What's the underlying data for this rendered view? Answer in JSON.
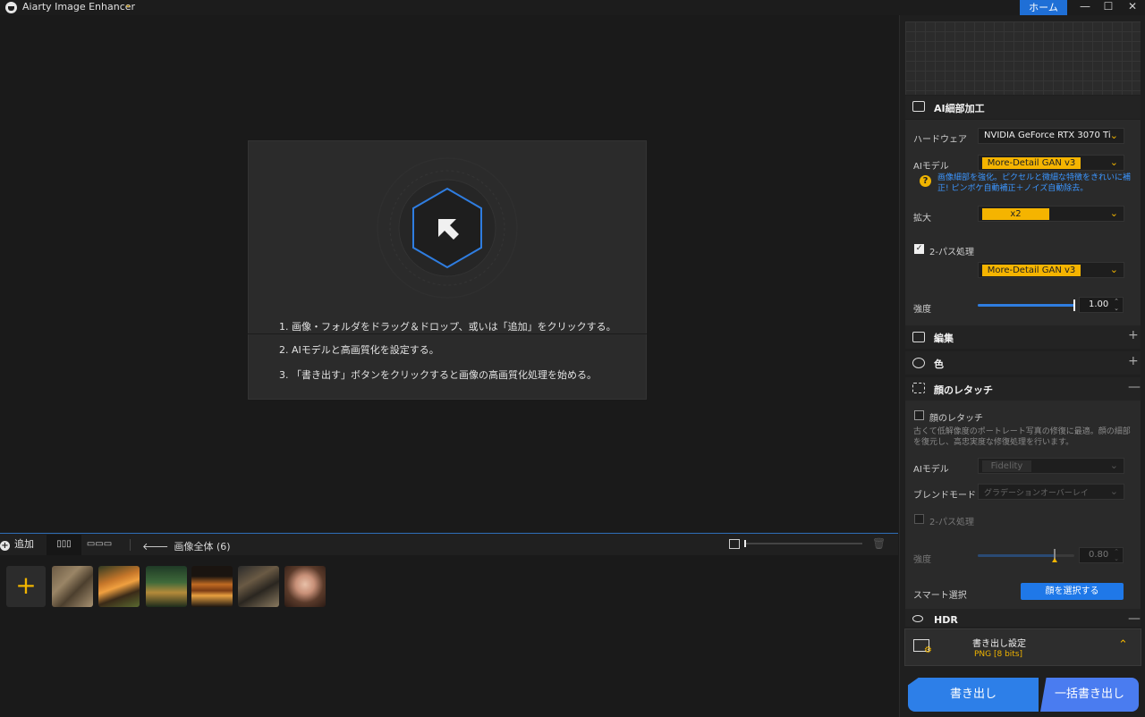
{
  "app": {
    "title": "Aiarty Image Enhancer",
    "title_chevron": "⌄"
  },
  "window": {
    "home_label": "ホーム",
    "minimize": "—",
    "maximize": "☐",
    "close": "✕"
  },
  "canvas": {
    "instructions": [
      "1. 画像・フォルダをドラッグ＆ドロップ、或いは「追加」をクリックする。",
      "2. AIモデルと高画質化を設定する。",
      "3. 「書き出す」ボタンをクリックすると画像の高画質化処理を始める。"
    ]
  },
  "bottombar": {
    "add_label": "追加",
    "add_plus": "+",
    "grid_view_icon": "▯▯▯",
    "strip_view_icon": "▭▭▭",
    "back_arrow": "🡐",
    "all_images_label": "画像全体 (6)",
    "add_tile_plus": "+",
    "thumbnails": [
      "owl",
      "tiger",
      "forest-scene",
      "burger",
      "dog-warrior",
      "woman-portrait"
    ]
  },
  "panel": {
    "ai_section": {
      "title": "AI細部加工",
      "hardware_label": "ハードウェア",
      "hardware_value": "NVIDIA GeForce RTX 3070 Ti",
      "model_label": "AIモデル",
      "model_value": "More-Detail GAN  v3",
      "model_desc": "画像細部を強化。ピクセルと微細な特徴をきれいに補正! ピンボケ自動補正＋ノイズ自動除去。",
      "scale_label": "拡大",
      "scale_value": "x2",
      "twopass_label": "2-パス処理",
      "twopass_checked": true,
      "twopass_model": "More-Detail GAN  v3",
      "strength_label": "強度",
      "strength_value": "1.00",
      "strength_level": 1.0
    },
    "edit_section": {
      "title": "編集",
      "toggle": "+"
    },
    "color_section": {
      "title": "色",
      "toggle": "+"
    },
    "face_section": {
      "title": "顔のレタッチ",
      "toggle": "—",
      "checkbox_label": "顔のレタッチ",
      "checked": false,
      "desc": "古くて低解像度のポートレート写真の修復に最適。顔の細部を復元し、高忠実度な修復処理を行います。",
      "model_label": "AIモデル",
      "model_value": "Fidelity",
      "blend_label": "ブレンドモード",
      "blend_value": "グラデーションオーバーレイ",
      "twopass_label": "2-パス処理",
      "strength_label": "強度",
      "strength_value": "0.80",
      "strength_level": 0.8,
      "smart_select_label": "スマート選択",
      "select_face_button": "顔を選択する"
    },
    "hdr_section": {
      "title": "HDR",
      "toggle": "—"
    },
    "export": {
      "settings_title": "書き出し設定",
      "format": "PNG   [8 bits]",
      "expand_icon": "⌃",
      "export_button": "書き出し",
      "batch_export_button": "一括書き出し"
    }
  },
  "colors": {
    "accent": "#f0b400",
    "primary": "#1f78e8",
    "panel": "#2a2a2a"
  }
}
